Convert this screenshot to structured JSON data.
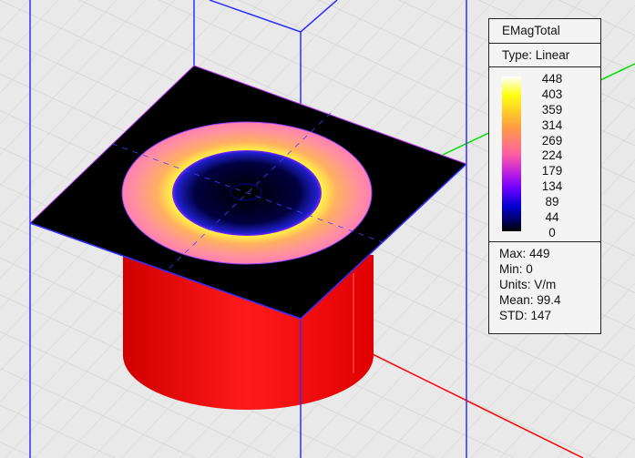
{
  "legend": {
    "title": "EMagTotal",
    "type": "Type: Linear",
    "ticks": [
      "448",
      "403",
      "359",
      "314",
      "269",
      "224",
      "179",
      "134",
      "89",
      "44",
      "0"
    ],
    "stats": [
      "Max: 449",
      "Min: 0",
      "Units: V/m",
      "Mean: 99.4",
      "STD: 147"
    ]
  },
  "colors": {
    "background": "#e9e9e9",
    "box": "#3030ff",
    "cylinder": "#ff1010",
    "plate": "#000000",
    "x_axis": "#ff0000",
    "y_axis": "#00dd00"
  }
}
